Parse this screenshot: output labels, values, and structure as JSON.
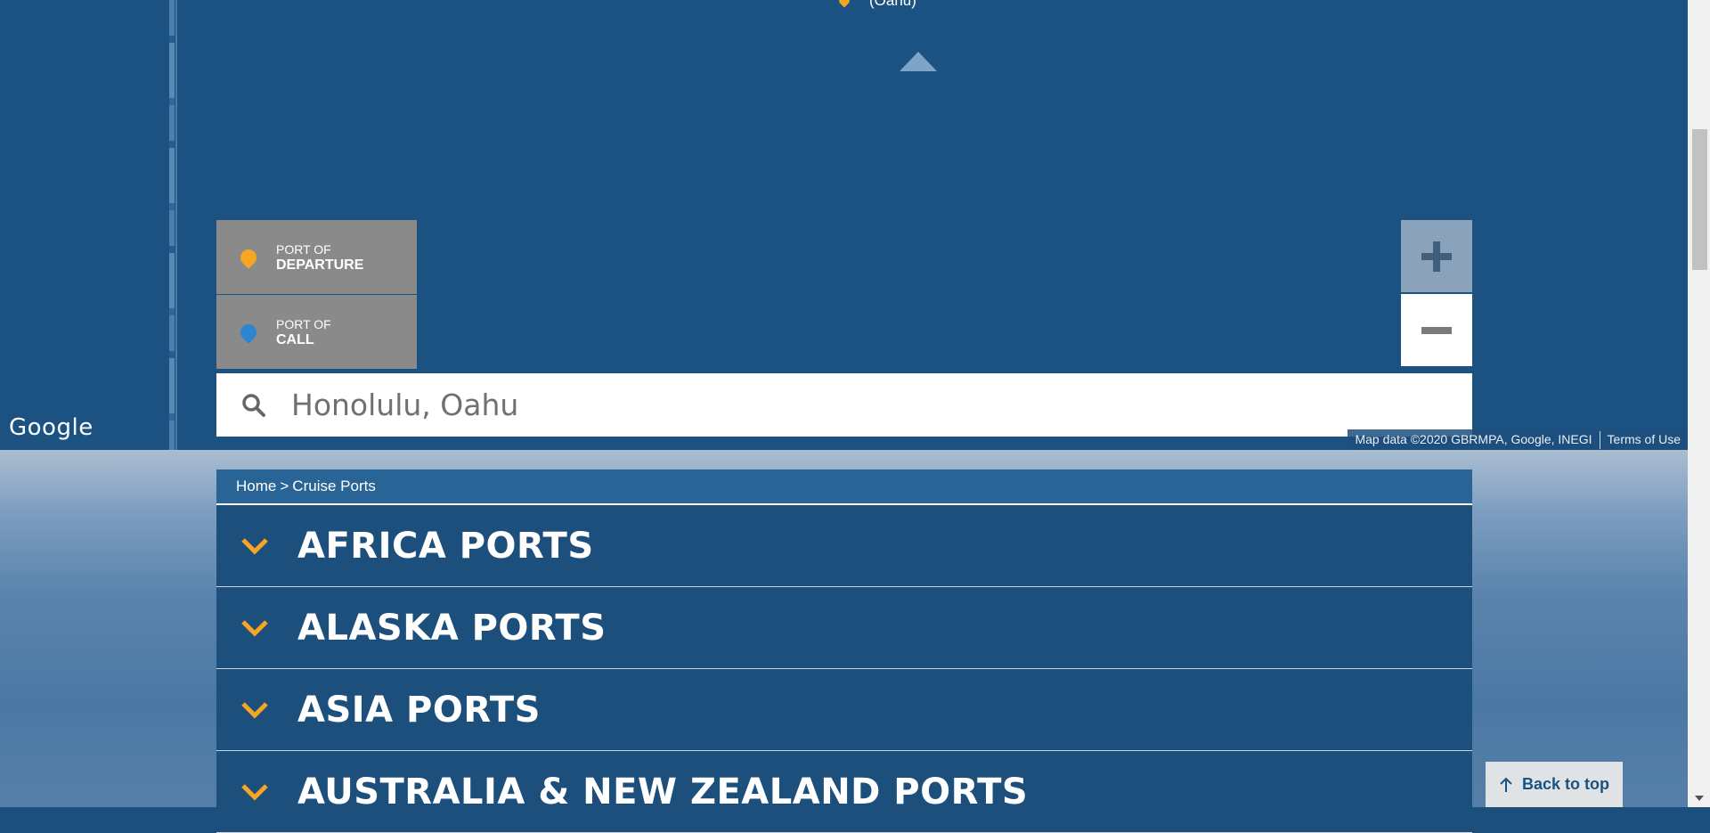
{
  "map": {
    "top_label": "(Oahu)",
    "google_logo": "Google",
    "attribution": "Map data ©2020 GBRMPA, Google, INEGI",
    "terms": "Terms of Use",
    "legend": {
      "departure": {
        "top": "PORT OF",
        "bottom": "DEPARTURE",
        "pin_color": "#f5a623"
      },
      "call": {
        "top": "PORT OF",
        "bottom": "CALL",
        "pin_color": "#2a86d1"
      }
    },
    "zoom_in_icon": "plus-icon",
    "zoom_out_icon": "minus-icon"
  },
  "search": {
    "value": "Honolulu, Oahu",
    "icon": "search-icon"
  },
  "breadcrumb": {
    "home": "Home",
    "separator": ">",
    "current": "Cruise Ports"
  },
  "regions": [
    {
      "label": "AFRICA PORTS"
    },
    {
      "label": "ALASKA PORTS"
    },
    {
      "label": "ASIA PORTS"
    },
    {
      "label": "AUSTRALIA & NEW ZEALAND PORTS"
    }
  ],
  "back_to_top": {
    "label": "Back to top",
    "icon": "arrow-up-icon"
  },
  "colors": {
    "accent": "#f5a623",
    "navy": "#1c4f7c",
    "breadcrumb_bg": "#286495"
  }
}
